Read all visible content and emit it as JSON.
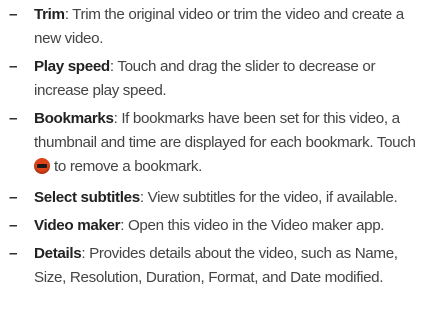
{
  "items": [
    {
      "dash": "–",
      "term": "Trim",
      "text": ": Trim the original video or trim the video and create a new video."
    },
    {
      "dash": "–",
      "term": "Play speed",
      "text": ": Touch and drag the slider to decrease or increase play speed."
    },
    {
      "dash": "–",
      "term": "Bookmarks",
      "text": ": If bookmarks have been set for this video, a thumbnail and time are displayed for each bookmark. Touch",
      "icon": "remove-bookmark-icon",
      "text_after": "to remove a bookmark."
    },
    {
      "dash": "–",
      "term": "Select subtitles",
      "text": ": View subtitles for the video, if available."
    },
    {
      "dash": "–",
      "term": "Video maker",
      "text": ": Open this video in the Video maker app."
    },
    {
      "dash": "–",
      "term": "Details",
      "text": ": Provides details about the video, such as Name, Size, Resolution, Duration, Format, and Date modified."
    }
  ]
}
